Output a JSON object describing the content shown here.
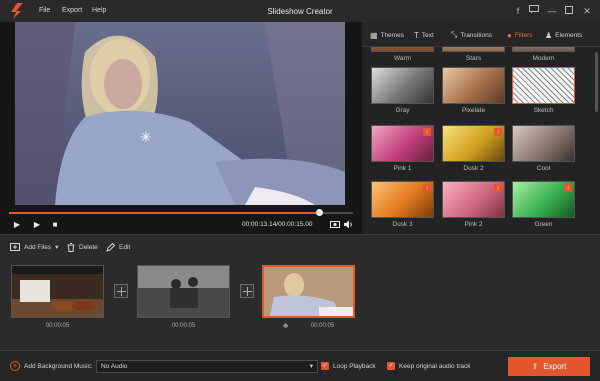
{
  "app": {
    "title": "Slideshow Creator"
  },
  "menu": [
    "File",
    "Export",
    "Help"
  ],
  "player": {
    "timecode": "00:00:13.14/00:00:15.00",
    "progress": 0.9
  },
  "tabs": [
    {
      "label": "Themes",
      "icon": "grid-icon"
    },
    {
      "label": "Text",
      "icon": "text-icon"
    },
    {
      "label": "Transitions",
      "icon": "transitions-icon"
    },
    {
      "label": "Filters",
      "icon": "filters-icon",
      "active": true
    },
    {
      "label": "Elements",
      "icon": "elements-icon"
    }
  ],
  "filters": [
    {
      "label": "Warm"
    },
    {
      "label": "Stars"
    },
    {
      "label": "Modern"
    },
    {
      "label": "Gray"
    },
    {
      "label": "Pixelate"
    },
    {
      "label": "Sketch",
      "selected": true
    },
    {
      "label": "Pink 1",
      "badge": true
    },
    {
      "label": "Dusk 2",
      "badge": true
    },
    {
      "label": "Cool"
    },
    {
      "label": "Dusk 3",
      "badge": true
    },
    {
      "label": "Pink 2",
      "badge": true
    },
    {
      "label": "Green",
      "badge": true
    }
  ],
  "toolbar": {
    "add_files": "Add Files",
    "delete": "Delete",
    "edit": "Edit"
  },
  "clips": [
    {
      "duration": "00:00:05"
    },
    {
      "duration": "00:00:05"
    },
    {
      "duration": "00:00:05",
      "selected": true
    }
  ],
  "bottom": {
    "bg_music_label": "Add Background Music:",
    "audio_value": "No Audio",
    "loop_label": "Loop Playback",
    "keep_audio_label": "Keep original audio track",
    "export_label": "Export"
  },
  "colors": {
    "accent": "#e4562e",
    "panel": "#232323",
    "background": "#2b2b2b"
  }
}
